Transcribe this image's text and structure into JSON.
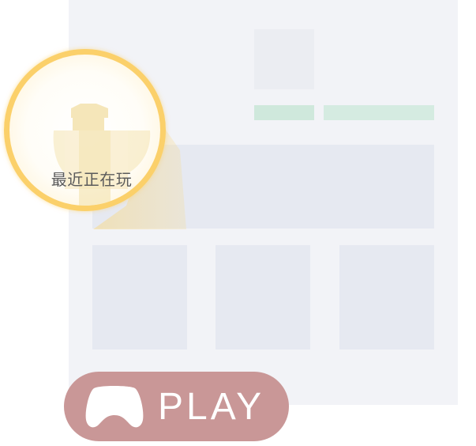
{
  "badge": {
    "label": "最近正在玩",
    "icon": "trophy-icon",
    "ring_color": "#fbd06a"
  },
  "play_button": {
    "label": "PLAY",
    "icon": "gamepad-icon",
    "color": "#c99797"
  },
  "colors": {
    "panel": "#f2f3f7",
    "placeholder": "#e6e9f1",
    "tag": "#cfe8dc"
  }
}
